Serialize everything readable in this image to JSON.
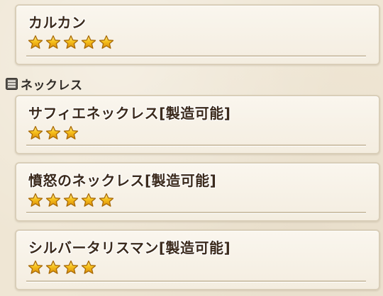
{
  "items_top": [
    {
      "name": "カルカン",
      "stars": 5
    }
  ],
  "section": {
    "label": "ネックレス",
    "icon": "equipment-box-icon"
  },
  "items": [
    {
      "name": "サフィエネックレス[製造可能]",
      "stars": 3
    },
    {
      "name": "憤怒のネックレス[製造可能]",
      "stars": 5
    },
    {
      "name": "シルバータリスマン[製造可能]",
      "stars": 4
    }
  ],
  "colors": {
    "star_fill": "#f7c21c",
    "star_stroke": "#a86a06",
    "text": "#3b2a1c",
    "panel_border": "#d9ceb8"
  }
}
